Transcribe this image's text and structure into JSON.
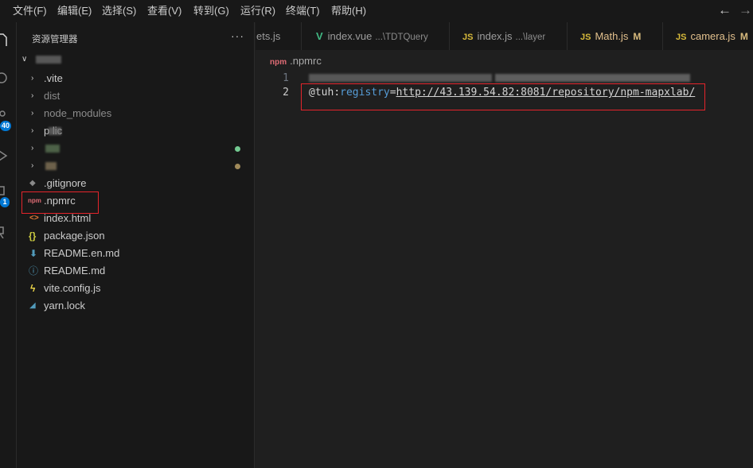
{
  "menu": [
    "文件(F)",
    "编辑(E)",
    "选择(S)",
    "查看(V)",
    "转到(G)",
    "运行(R)",
    "终端(T)",
    "帮助(H)"
  ],
  "nav": {
    "back": "←",
    "forward": "→"
  },
  "activity_bar": {
    "scm_badge": "40",
    "extensions_badge": "1"
  },
  "explorer": {
    "title": "资源管理器",
    "more": "···",
    "items": [
      {
        "label": ".vite",
        "type": "folder"
      },
      {
        "label": "dist",
        "type": "folder"
      },
      {
        "label": "node_modules",
        "type": "folder"
      },
      {
        "label": "p lic",
        "type": "folder"
      },
      {
        "label": "",
        "type": "folder"
      },
      {
        "label": "",
        "type": "folder"
      },
      {
        "label": ".gitignore",
        "type": "file",
        "icon": "◆"
      },
      {
        "label": ".npmrc",
        "type": "file",
        "icon": "npm"
      },
      {
        "label": "index.html",
        "type": "file",
        "icon": "<>"
      },
      {
        "label": "package.json",
        "type": "file",
        "icon": "{}"
      },
      {
        "label": "README.en.md",
        "type": "file",
        "icon": "⬇"
      },
      {
        "label": "README.md",
        "type": "file",
        "icon": "ⓘ"
      },
      {
        "label": "vite.config.js",
        "type": "file",
        "icon": "ϟ"
      },
      {
        "label": "yarn.lock",
        "type": "file",
        "icon": "◢"
      }
    ]
  },
  "tabs": [
    {
      "name": "ets.js",
      "desc": "",
      "mod": ""
    },
    {
      "name": "index.vue",
      "desc": "...\\TDTQuery",
      "mod": ""
    },
    {
      "name": "index.js",
      "desc": "...\\layer",
      "mod": ""
    },
    {
      "name": "Math.js",
      "desc": "",
      "mod": "M"
    },
    {
      "name": "camera.js",
      "desc": "",
      "mod": "M"
    }
  ],
  "tab_icons": {
    "vue": "V",
    "js": "JS"
  },
  "editor": {
    "breadcrumb": ".npmrc",
    "breadcrumb_icon": "npm",
    "line_numbers": [
      "1",
      "2"
    ],
    "line2": {
      "scope": "@tuh",
      "sep": ":",
      "key": "registry",
      "eq": "=",
      "url": "http://43.139.54.82:8081/repository/npm-mapxlab/"
    }
  },
  "colors": {
    "accent": "#0078d4",
    "highlight_box": "#e5242b",
    "js_icon": "#d7ba3b",
    "vue_icon": "#41b883",
    "git_added": "#73c991",
    "git_modified": "#e2c08d"
  }
}
